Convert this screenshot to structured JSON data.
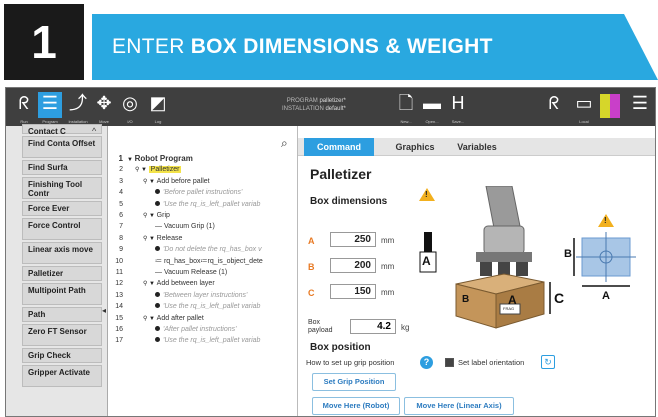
{
  "banner": {
    "step": "1",
    "title_prefix": "ENTER",
    "title_bold": "BOX DIMENSIONS & WEIGHT"
  },
  "topbar": {
    "icons": [
      {
        "name": "ur-logo-icon",
        "glyph": "ᖇ",
        "label": "Run"
      },
      {
        "name": "program-icon",
        "glyph": "☰",
        "label": "Program"
      },
      {
        "name": "installation-icon",
        "glyph": "⤴",
        "label": "Installation"
      },
      {
        "name": "move-icon",
        "glyph": "✥",
        "label": "Move"
      },
      {
        "name": "io-icon",
        "glyph": "◎",
        "label": "I/O"
      },
      {
        "name": "log-icon",
        "glyph": "◩",
        "label": "Log"
      }
    ],
    "program_label": "PROGRAM",
    "program_name": "palletizer*",
    "installation_label": "INSTALLATION",
    "installation_name": "default*",
    "file_icons": [
      {
        "name": "new-icon",
        "glyph": "🗋",
        "label": "New..."
      },
      {
        "name": "open-icon",
        "glyph": "▬",
        "label": "Open..."
      },
      {
        "name": "save-icon",
        "glyph": "H",
        "label": "Save..."
      }
    ],
    "right_icons": [
      {
        "name": "urcaps-icon",
        "glyph": "ᖇ"
      },
      {
        "name": "local-icon",
        "glyph": "▭",
        "label": "Local"
      },
      {
        "name": "speed-icon",
        "glyph": "▚"
      },
      {
        "name": "menu-icon",
        "glyph": "☰"
      }
    ]
  },
  "sidebar": {
    "items": [
      "Contact C",
      "Find Conta Offset",
      "Find Surfa",
      "Finishing Tool Contr",
      "Force Ever",
      "Force Control",
      "Linear axis move",
      "Palletizer",
      "Multipoint Path",
      "Path",
      "Zero FT Sensor",
      "Grip Check",
      "Gripper Activate"
    ]
  },
  "tree": {
    "rows": [
      {
        "n": "1",
        "text": "Robot Program",
        "indent": 0,
        "kind": "root"
      },
      {
        "n": "2",
        "text": "Palletizer",
        "indent": 1,
        "kind": "pal"
      },
      {
        "n": "3",
        "text": "Add before pallet",
        "indent": 2,
        "kind": "fold"
      },
      {
        "n": "4",
        "text": "'Before pallet instructions'",
        "indent": 3,
        "kind": "comment"
      },
      {
        "n": "5",
        "text": "'Use the rq_is_left_pallet variab",
        "indent": 3,
        "kind": "comment"
      },
      {
        "n": "6",
        "text": "Grip",
        "indent": 2,
        "kind": "fold"
      },
      {
        "n": "7",
        "text": "Vacuum Grip  (1)",
        "indent": 3,
        "kind": "dash"
      },
      {
        "n": "8",
        "text": "Release",
        "indent": 2,
        "kind": "fold"
      },
      {
        "n": "9",
        "text": "'Do not delete the rq_has_box v",
        "indent": 3,
        "kind": "comment"
      },
      {
        "n": "10",
        "text": "rq_has_box≔rq_is_object_dete",
        "indent": 3,
        "kind": "assign"
      },
      {
        "n": "11",
        "text": "Vacuum Release  (1)",
        "indent": 3,
        "kind": "dash"
      },
      {
        "n": "12",
        "text": "Add between layer",
        "indent": 2,
        "kind": "fold"
      },
      {
        "n": "13",
        "text": "'Between layer instructions'",
        "indent": 3,
        "kind": "comment"
      },
      {
        "n": "14",
        "text": "'Use the rq_is_left_pallet variab",
        "indent": 3,
        "kind": "comment"
      },
      {
        "n": "15",
        "text": "Add after pallet",
        "indent": 2,
        "kind": "fold"
      },
      {
        "n": "16",
        "text": "'After pallet instructions'",
        "indent": 3,
        "kind": "comment"
      },
      {
        "n": "17",
        "text": "'Use the rq_is_left_pallet variab",
        "indent": 3,
        "kind": "comment"
      }
    ]
  },
  "tabs": [
    "Command",
    "Graphics",
    "Variables"
  ],
  "panel": {
    "title": "Palletizer",
    "box_dimensions_title": "Box dimensions",
    "dims": [
      {
        "label": "A",
        "value": "250",
        "unit": "mm"
      },
      {
        "label": "B",
        "value": "200",
        "unit": "mm"
      },
      {
        "label": "C",
        "value": "150",
        "unit": "mm"
      }
    ],
    "payload_label": "Box payload",
    "payload_value": "4.2",
    "payload_unit": "kg",
    "box_position_title": "Box position",
    "grip_position_text": "How to set up grip position",
    "label_orientation_text": "Set label orientation",
    "buttons": {
      "set_grip": "Set Grip Position",
      "move_robot": "Move Here (Robot)",
      "move_linear": "Move Here (Linear Axis)"
    }
  },
  "illustration": {
    "labels": [
      "A",
      "A",
      "B",
      "B",
      "C",
      "A"
    ],
    "box_label": "FRAG"
  },
  "colors": {
    "banner": "#29a8e0",
    "accent": "#2d9ee0",
    "warning": "#f2b01e",
    "dim_label": "#e87a24"
  }
}
